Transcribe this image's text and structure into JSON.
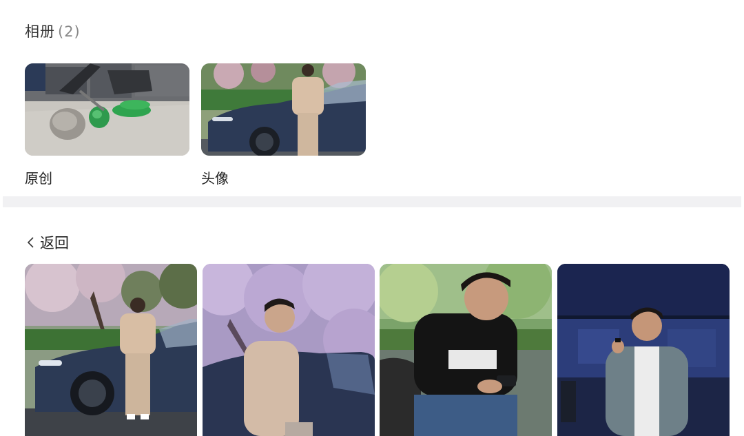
{
  "albums": {
    "title": "相册",
    "count": "(2)",
    "items": [
      {
        "label": "原创",
        "icon": "gym-photo"
      },
      {
        "label": "头像",
        "icon": "car-portrait-photo"
      }
    ]
  },
  "back": {
    "label": "返回",
    "icon": "chevron-left-icon"
  },
  "photos": [
    {
      "icon": "car-blossom-photo"
    },
    {
      "icon": "blossom-portrait-photo"
    },
    {
      "icon": "phone-black-tee-photo"
    },
    {
      "icon": "stage-speaker-photo"
    }
  ],
  "colors": {
    "divider": "#f1f1f3",
    "text": "#222222",
    "muted": "#888888"
  }
}
